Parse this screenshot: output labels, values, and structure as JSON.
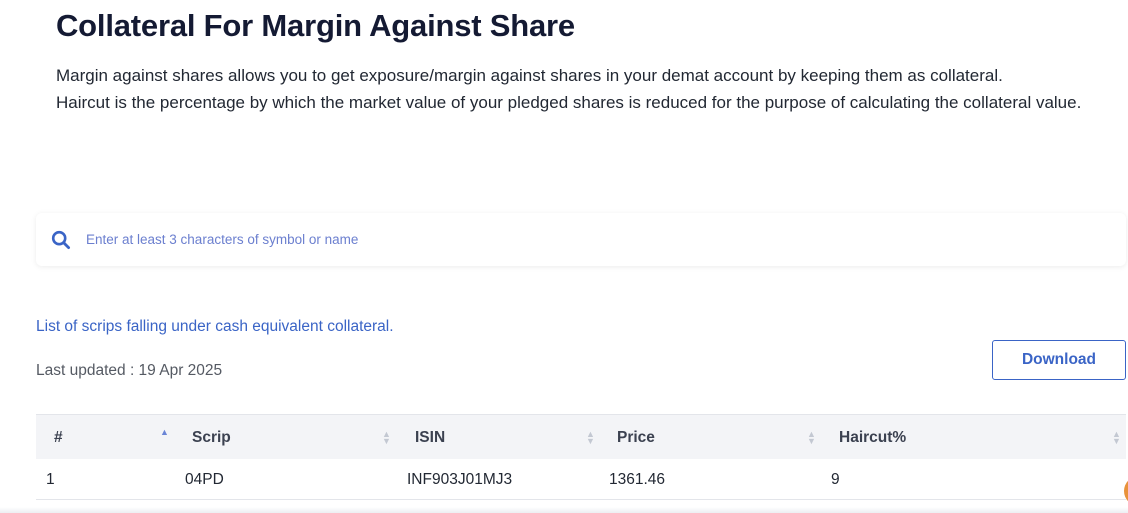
{
  "header": {
    "title": "Collateral For Margin Against Share",
    "intro_line1": "Margin against shares allows you to get exposure/margin against shares in your demat account by keeping them as collateral.",
    "intro_line2": "Haircut is the percentage by which the market value of your pledged shares is reduced for the purpose of calculating the collateral value."
  },
  "search": {
    "icon": "search-icon",
    "placeholder": "Enter at least 3 characters of symbol or name",
    "value": ""
  },
  "info": {
    "link_text": "List of scrips falling under cash equivalent collateral.",
    "last_updated": "Last updated : 19 Apr 2025"
  },
  "toolbar": {
    "download_label": "Download"
  },
  "table": {
    "columns": [
      "#",
      "Scrip",
      "ISIN",
      "Price",
      "Haircut%"
    ],
    "rows": [
      [
        "1",
        "04PD",
        "INF903J01MJ3",
        "1361.46",
        "9"
      ]
    ]
  },
  "colors": {
    "accent": "#3a64c6",
    "title": "#141a33",
    "header_bg": "#f3f4f7",
    "help_bubble": "#e8923b"
  }
}
